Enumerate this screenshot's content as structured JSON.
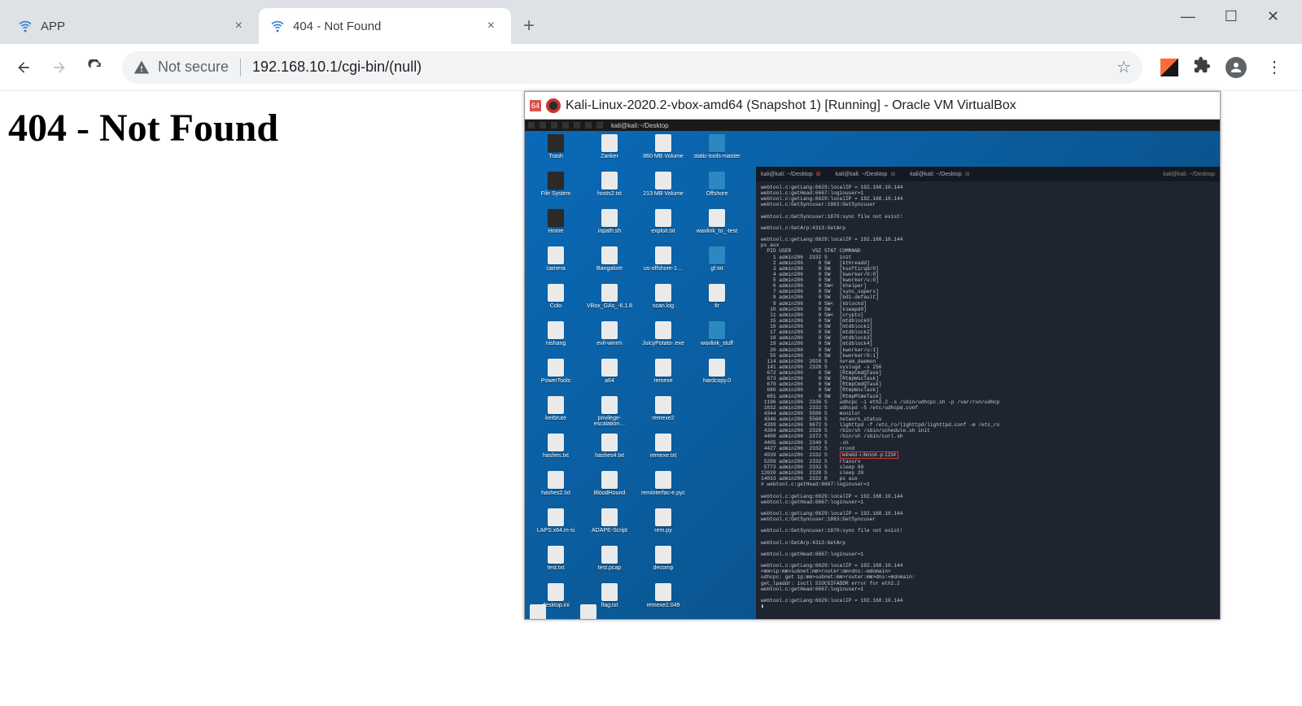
{
  "window_controls": {
    "min": "—",
    "max": "☐",
    "close": "✕"
  },
  "tabs": [
    {
      "title": "APP",
      "active": false
    },
    {
      "title": "404 - Not Found",
      "active": true
    }
  ],
  "newtab": "+",
  "toolbar": {
    "back": "←",
    "forward": "→",
    "reload": "⟳",
    "security_label": "Not secure",
    "url": "192.168.10.1/cgi-bin/(null)",
    "star": "☆",
    "menu": "⋮"
  },
  "page": {
    "heading": "404 - Not Found"
  },
  "vm": {
    "badge": "64",
    "title": "Kali-Linux-2020.2-vbox-amd64 (Snapshot 1) [Running] - Oracle VM VirtualBox",
    "taskbar_text": "kali@kali:~/Desktop",
    "desktop_icons": [
      "Trash",
      "Zanker",
      "860 MB Volume",
      "static-tools-master",
      "File System",
      "hosts2.txt",
      "213 MB Volume",
      "Offshore",
      "Home",
      "inpath.sh",
      "exploit.txt",
      "wavlink_to_-test",
      "camera",
      "Bangalore",
      "us-offshore-1…",
      "gf.txt",
      "Colo",
      "VBox_GAs_-6.1.8",
      "scan.log",
      "fir",
      "nishang",
      "evil-winrm",
      "JuicyPotato-.exe",
      "wavlink_stuff",
      "PowerTools",
      "a64",
      "remexe",
      "hardcopy.0",
      "kerbrute",
      "privilege-escalation…",
      "remexe2",
      "",
      "hashes.txt",
      "hashes4.txt",
      "remexe.txt",
      "",
      "hashes2.txt",
      "BloodHound",
      "reminterfac-e.pyc",
      "",
      "LAPS.x64.m-si",
      "ADAPE-Script",
      "rem.py",
      "",
      "test.txt",
      "test.pcap",
      "decomp",
      "",
      "desktop.ini",
      "flag.txt",
      "remexe2.049",
      ""
    ],
    "term_tabs": [
      {
        "label": "kali@kali: ~/Desktop",
        "active": true
      },
      {
        "label": "kali@kali: ~/Desktop",
        "active": false
      },
      {
        "label": "kali@kali: ~/Desktop",
        "active": false
      }
    ],
    "term_tabs_right": "kali@kali: ~/Desktop",
    "term_lines": [
      "webtool.c:getLang:6629:localIP = 192.168.10.144",
      "webtool.c:getHead:6667:loginuser=1",
      "webtool.c:getLang:6629:localIP = 192.168.10.144",
      "webtool.c:GetSyncuser:1863:GetSyncuser",
      "",
      "webtool.c:GetSyncuser:1870:sync file not exist!",
      "",
      "webtool.c:GetArp:4313:GetArp",
      "",
      "webtool.c:getLang:6629:localIP = 192.168.10.144",
      "ps aux",
      "  PID USER       VSZ STAT COMMAND",
      "    1 admin286  2332 S    init",
      "    2 admin286     0 SW   [kthreadd]",
      "    3 admin286     0 SW   [ksoftirqd/0]",
      "    4 admin286     0 SW   [kworker/0:0]",
      "    5 admin286     0 SW   [kworker/u:0]",
      "    6 admin286     0 SW<  [khelper]",
      "    7 admin286     0 SW   [sync_supers]",
      "    8 admin286     0 SW   [bdi-default]",
      "    9 admin286     0 SW<  [kblockd]",
      "   10 admin286     0 SW   [kswapd0]",
      "   11 admin286     0 SW<  [crypto]",
      "   15 admin286     0 SW   [mtdblock0]",
      "   16 admin286     0 SW   [mtdblock1]",
      "   17 admin286     0 SW   [mtdblock2]",
      "   18 admin286     0 SW   [mtdblock3]",
      "   19 admin286     0 SW   [mtdblock4]",
      "   20 admin286     0 SW   [kworker/u:1]",
      "   55 admin286     0 SW   [kworker/0:1]",
      "  114 admin286  2028 S    nvram_daemon",
      "  141 admin286  2328 S    syslogd -s 256",
      "  672 admin286     0 SW   [RtmpCmdQTask]",
      "  673 admin286     0 SW   [RtmpWscTask]",
      "  679 admin286     0 SW   [RtmpCmdQTask]",
      "  680 admin286     0 SW   [RtmpWscTask]",
      "  681 admin286     0 SW   [RtmpMlmeTask]",
      " 1196 admin286  2336 S    udhcpc -i eth2.2 -s /sbin/udhcpc.sh -p /var/run/udhcp",
      " 1632 admin286  2332 S    udhcpd -S /etc/udhcpd.conf",
      " 4344 admin286  5588 S    monitor",
      " 4346 admin286  5560 S    network_status",
      " 4399 admin286  9672 S    lighttpd -f /etc_ro/lighttpd/lighttpd.conf -m /etc_ro",
      " 4394 admin286  2328 S    /bin/sh /sbin/schedule.sh init",
      " 4400 admin286  2372 S    /bin/sh /sbin/curl.sh",
      " 4405 admin286  2340 S    -sh",
      " 4427 admin286  2332 S    crond",
      " 4939 admin286  2332 S    HIGHLIGHT:telnetd -l /bin/sh -p 1234",
      " 5259 admin286  2332 S    rtaosrv",
      " 5773 admin286  2332 S    sleep 60",
      "12020 admin286  2328 S    sleep 20",
      "14033 admin286  2332 R    ps aux",
      "# webtool.c:getHead:6667:loginuser=1",
      "",
      "webtool.c:getLang:6629:localIP = 192.168.10.144",
      "webtool.c:getHead:6667:loginuser=1",
      "",
      "webtool.c:getLang:6629:localIP = 192.168.10.144",
      "webtool.c:GetSyncuser:1863:GetSyncuser",
      "",
      "webtool.c:GetSyncuser:1870:sync file not exist!",
      "",
      "webtool.c:GetArp:4313:GetArp",
      "",
      "webtool.c:getHead:6667:loginuser=1",
      "",
      "webtool.c:getLang:6629:localIP = 192.168.10.144",
      "<mm>ip:mm>subnet:mm>router:mm>dns:-mdomain>",
      "udhcpc: get ip:mm>subnet:mm>router:mm>dns:=mdomain:",
      "get_lpaddr: ioctl SIOCGIFADDR error for eth2.2",
      "webtool.c:getHead:6667:loginuser=1",
      "",
      "webtool.c:getLang:6629:localIP = 192.168.10.144",
      "▮"
    ]
  }
}
